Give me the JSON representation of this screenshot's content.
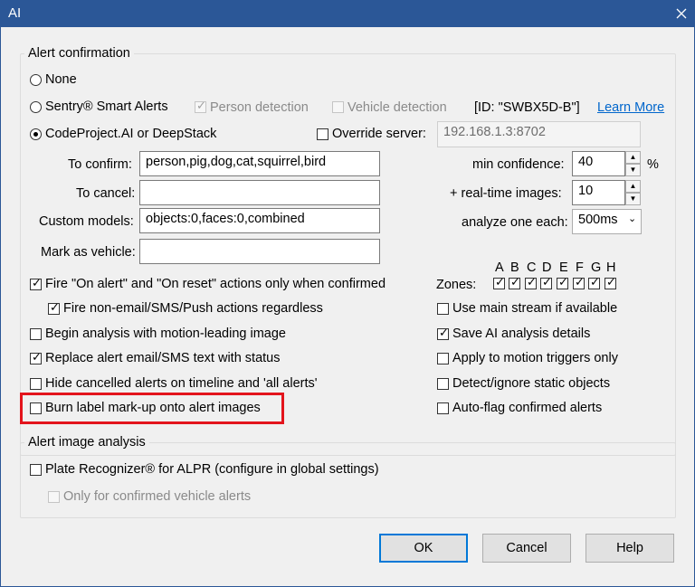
{
  "window": {
    "title": "AI"
  },
  "alert_confirmation": {
    "legend": "Alert confirmation",
    "none_label": "None",
    "sentry_label": "Sentry® Smart Alerts",
    "person_detection_label": "Person detection",
    "vehicle_detection_label": "Vehicle detection",
    "id_text": "[ID: \"SWBX5D-B\"]",
    "learn_more_label": "Learn More",
    "codeproject_label": "CodeProject.AI or DeepStack",
    "override_server_label": "Override server:",
    "override_server_value": "192.168.1.3:8702",
    "to_confirm_label": "To confirm:",
    "to_confirm_value": "person,pig,dog,cat,squirrel,bird",
    "to_cancel_label": "To cancel:",
    "to_cancel_value": "",
    "custom_models_label": "Custom models:",
    "custom_models_value": "objects:0,faces:0,combined",
    "mark_vehicle_label": "Mark as vehicle:",
    "mark_vehicle_value": "",
    "min_confidence_label": "min confidence:",
    "min_confidence_value": "40",
    "percent_label": "%",
    "realtime_images_label": "+ real-time images:",
    "realtime_images_value": "10",
    "analyze_each_label": "analyze one each:",
    "analyze_each_value": "500ms",
    "fire_actions_label": "Fire \"On alert\" and \"On reset\" actions only when confirmed",
    "fire_nonemail_label": "Fire non-email/SMS/Push actions regardless",
    "begin_analysis_label": "Begin analysis with motion-leading image",
    "replace_alert_label": "Replace alert email/SMS text with status",
    "hide_cancelled_label": "Hide cancelled alerts on timeline and  'all alerts'",
    "burn_label": "Burn label mark-up onto alert images",
    "zones_label": "Zones:",
    "zone_letters": [
      "A",
      "B",
      "C",
      "D",
      "E",
      "F",
      "G",
      "H"
    ],
    "main_stream_label": "Use main stream if available",
    "save_ai_label": "Save AI analysis details",
    "apply_motion_label": "Apply to motion triggers only",
    "detect_static_label": "Detect/ignore static objects",
    "auto_flag_label": "Auto-flag confirmed alerts"
  },
  "alert_image_analysis": {
    "legend": "Alert image analysis",
    "plate_label": "Plate Recognizer® for ALPR (configure in global settings)",
    "only_vehicle_label": "Only for confirmed vehicle alerts"
  },
  "buttons": {
    "ok": "OK",
    "cancel": "Cancel",
    "help": "Help"
  },
  "colors": {
    "title_bar": "#2b5797",
    "highlight": "#e3141c",
    "link": "#0066cc",
    "default_button": "#0078d7"
  }
}
